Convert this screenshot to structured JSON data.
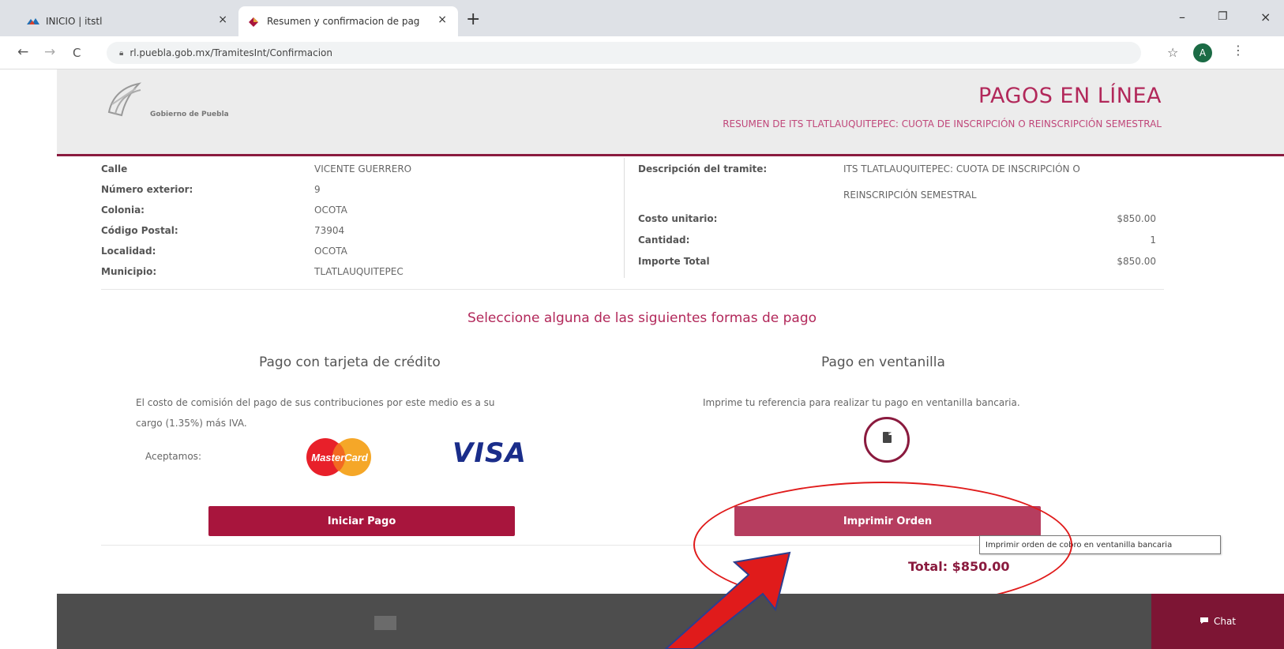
{
  "browser": {
    "tabs": [
      {
        "label": "INICIO | itstl",
        "active": false
      },
      {
        "label": "Resumen y confirmacion de pag",
        "active": true
      }
    ],
    "new_tab": "+",
    "close_glyph": "×",
    "window_controls": {
      "minimize": "–",
      "maximize": "❐",
      "close": "×"
    },
    "nav": {
      "back": "←",
      "forward": "→",
      "reload": "C"
    },
    "url": "rl.puebla.gob.mx/TramitesInt/Confirmacion",
    "profile_initial": "A",
    "star": "☆",
    "menu": "⋮"
  },
  "header": {
    "logo_text": "Gobierno de Puebla",
    "title": "PAGOS EN LÍNEA",
    "subtitle": "RESUMEN DE ITS TLATLAUQUITEPEC: CUOTA DE INSCRIPCIÓN O REINSCRIPCIÓN SEMESTRAL"
  },
  "address": {
    "calle_label": "Calle",
    "calle_value": "VICENTE GUERRERO",
    "numero_label": "Número exterior:",
    "numero_value": "9",
    "colonia_label": "Colonia:",
    "colonia_value": "OCOTA",
    "cp_label": "Código Postal:",
    "cp_value": "73904",
    "localidad_label": "Localidad:",
    "localidad_value": "OCOTA",
    "municipio_label": "Municipio:",
    "municipio_value": "TLATLAUQUITEPEC"
  },
  "summary": {
    "descripcion_label": "Descripción del tramite:",
    "descripcion_line1": "ITS TLATLAUQUITEPEC: CUOTA DE INSCRIPCIÓN O",
    "descripcion_line2": "REINSCRIPCIÓN SEMESTRAL",
    "costo_label": "Costo unitario:",
    "costo_value": "$850.00",
    "cantidad_label": "Cantidad:",
    "cantidad_value": "1",
    "importe_label": "Importe Total",
    "importe_value": "$850.00"
  },
  "payment": {
    "select_title": "Seleccione alguna de las siguientes formas de pago",
    "card": {
      "heading": "Pago con tarjeta de crédito",
      "text_line1": "El costo de comisión del pago de sus contribuciones por este medio es a su",
      "text_line2": "cargo (1.35%) más IVA.",
      "accept_label": "Aceptamos:",
      "mastercard_label": "MasterCard",
      "visa_label": "VISA",
      "button": "Iniciar Pago"
    },
    "window": {
      "heading": "Pago en ventanilla",
      "text": "Imprime tu referencia para realizar tu pago en ventanilla bancaria.",
      "button": "Imprimir Orden",
      "tooltip": "Imprimir orden de cobro en ventanilla bancaria"
    },
    "total": "Total: $850.00"
  },
  "chat": {
    "label": "Chat",
    "icon": "chat-icon"
  },
  "colors": {
    "brand": "#b2285a",
    "primary_button": "#a8153d",
    "secondary_button": "#b63d5f",
    "annotation_red": "#e01b1b"
  }
}
